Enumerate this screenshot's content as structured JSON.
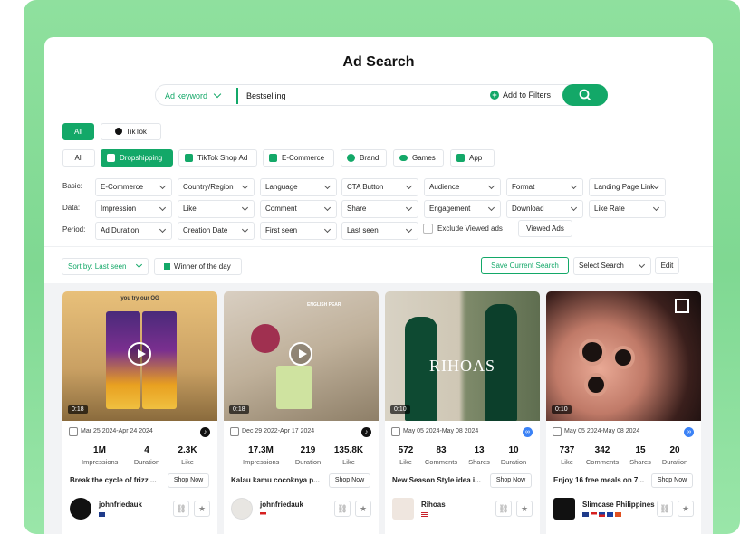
{
  "page": {
    "title": "Ad Search"
  },
  "search": {
    "type_label": "Ad keyword",
    "value": "Bestselling",
    "add_filters": "Add to Filters"
  },
  "platform_tabs": [
    "All",
    "TikTok"
  ],
  "category_chips": [
    "All",
    "Dropshipping",
    "TikTok Shop Ad",
    "E-Commerce",
    "Brand",
    "Games",
    "App"
  ],
  "filters": {
    "basic_label": "Basic:",
    "basic": [
      "E-Commerce",
      "Country/Region",
      "Language",
      "CTA Button",
      "Audience",
      "Format",
      "Landing Page Link"
    ],
    "data_label": "Data:",
    "data": [
      "Impression",
      "Like",
      "Comment",
      "Share",
      "Engagement",
      "Download",
      "Like Rate"
    ],
    "period_label": "Period:",
    "period": [
      "Ad Duration",
      "Creation Date",
      "First seen",
      "Last seen"
    ],
    "exclude_viewed": "Exclude Viewed ads",
    "viewed_ads": "Viewed Ads"
  },
  "toolbar": {
    "sort": "Sort by: Last seen",
    "winner": "Winner of the day",
    "save_search": "Save Current Search",
    "select_search": "Select Search",
    "edit": "Edit"
  },
  "colors": {
    "accent": "#13a868",
    "background_gradient": "#8fe09e"
  },
  "ads": [
    {
      "duration": "0:18",
      "date": "Mar 25 2024-Apr 24 2024",
      "platform": "tiktok",
      "stats": [
        {
          "v": "1M",
          "l": "Impressions"
        },
        {
          "v": "4",
          "l": "Duration"
        },
        {
          "v": "2.3K",
          "l": "Like"
        }
      ],
      "desc": "Break the cycle of frizz ...",
      "cta": "Shop Now",
      "advertiser": "johnfriedauk",
      "thumb_text": "you try our OG",
      "flags": [
        "au"
      ]
    },
    {
      "duration": "0:18",
      "date": "Dec 29 2022-Apr 17 2024",
      "platform": "tiktok",
      "stats": [
        {
          "v": "17.3M",
          "l": "Impressions"
        },
        {
          "v": "219",
          "l": "Duration"
        },
        {
          "v": "135.8K",
          "l": "Like"
        }
      ],
      "desc": "Kalau kamu cocoknya p...",
      "cta": "Shop Now",
      "advertiser": "johnfriedauk",
      "thumb_text": "ENGLISH PEAR",
      "flags": [
        "id"
      ]
    },
    {
      "duration": "0:10",
      "date": "May 05 2024-May 08 2024",
      "platform": "meta",
      "stats": [
        {
          "v": "572",
          "l": "Like"
        },
        {
          "v": "83",
          "l": "Comments"
        },
        {
          "v": "13",
          "l": "Shares"
        },
        {
          "v": "10",
          "l": "Duration"
        }
      ],
      "desc": "New Season Style idea i...",
      "cta": "Shop Now",
      "advertiser": "Rihoas",
      "thumb_text": "RIHOAS",
      "flags": [
        "us"
      ]
    },
    {
      "duration": "0:10",
      "date": "May 05 2024-May 08 2024",
      "platform": "meta",
      "stats": [
        {
          "v": "737",
          "l": "Like"
        },
        {
          "v": "342",
          "l": "Comments"
        },
        {
          "v": "15",
          "l": "Shares"
        },
        {
          "v": "20",
          "l": "Duration"
        }
      ],
      "desc": "Enjoy 16 free meals on 7...",
      "cta": "Shop Now",
      "advertiser": "Slimcase Philippines",
      "thumb_text": "",
      "flags": [
        "au",
        "my",
        "ph",
        "is",
        "sg"
      ]
    }
  ]
}
